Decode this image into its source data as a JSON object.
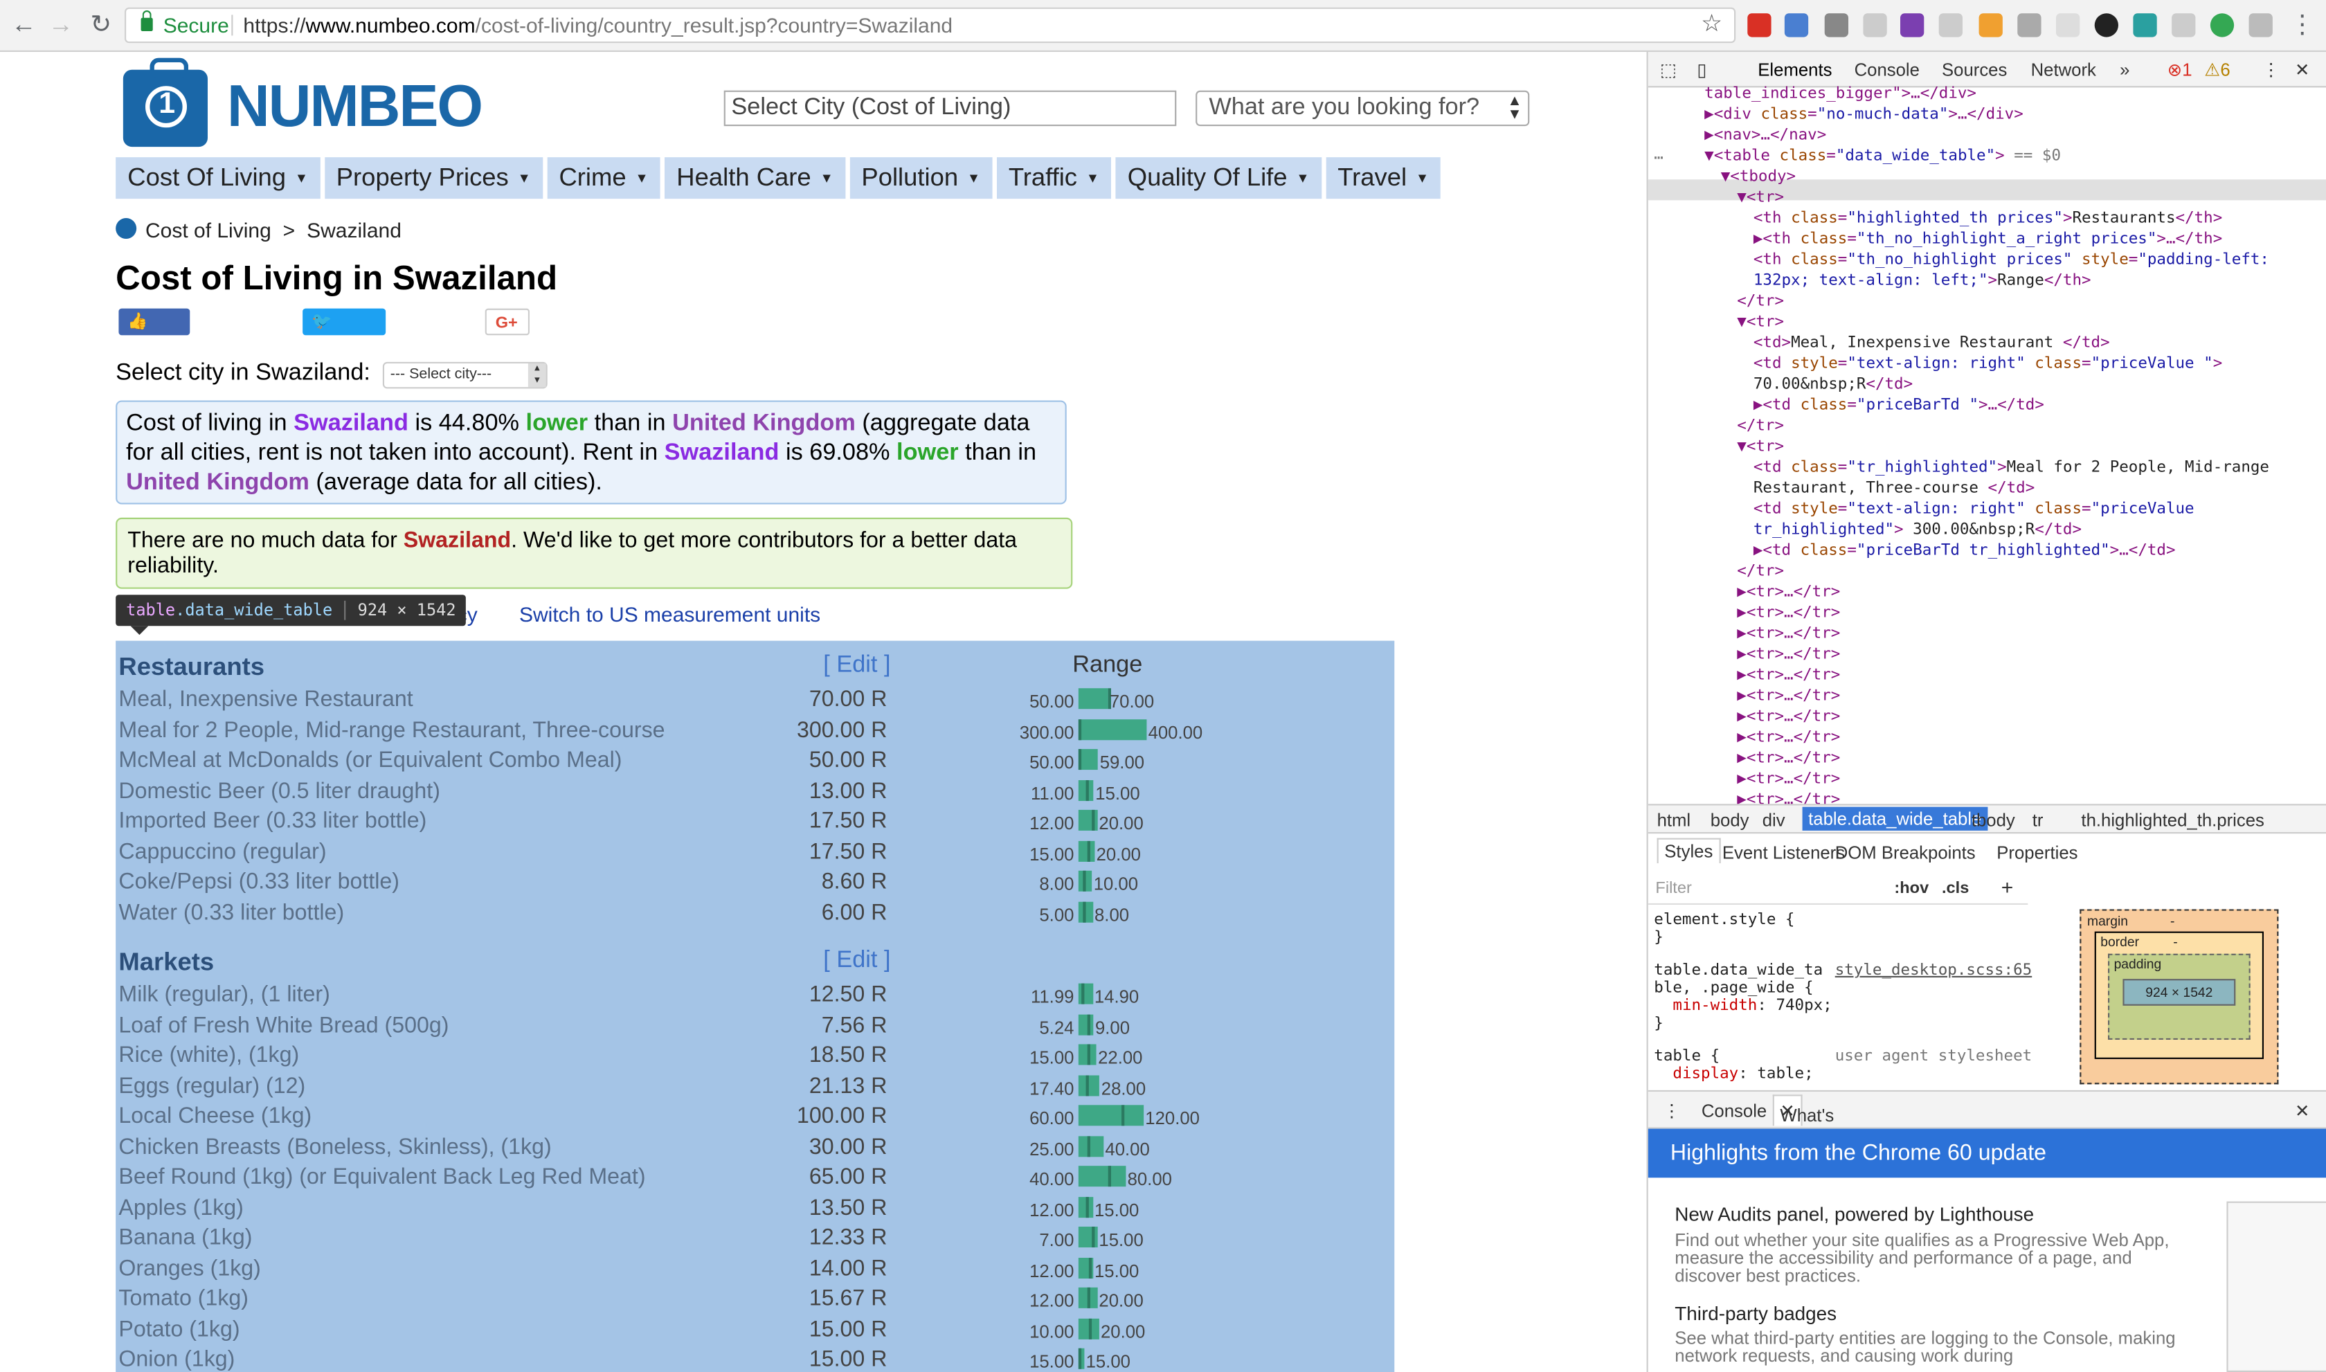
{
  "browser": {
    "secure_label": "Secure",
    "url_scheme": "https://",
    "url_host": "www.numbeo.com",
    "url_path": "/cost-of-living/country_result.jsp?country=Swaziland"
  },
  "site": {
    "logo_text": "NUMBEO",
    "city_select_placeholder": "Select City (Cost of Living)",
    "search_placeholder": "What are you looking for?",
    "menu": [
      "Cost Of Living",
      "Property Prices",
      "Crime",
      "Health Care",
      "Pollution",
      "Traffic",
      "Quality Of Life",
      "Travel"
    ],
    "breadcrumb": {
      "home": "Cost of Living",
      "sep": ">",
      "current": "Swaziland"
    },
    "title": "Cost of Living in Swaziland",
    "social": {
      "like": "Like",
      "tweet": "Tweet",
      "gplus": "G+"
    },
    "select_city_label": "Select city in Swaziland:",
    "select_city_value": "--- Select city---",
    "info": {
      "p1": "Cost of living in ",
      "country": "Swaziland",
      "p2": " is 44.80% ",
      "lower": "lower",
      "p3": " than in ",
      "uk": "United Kingdom",
      "p4": " (aggregate data for all cities, rent is not taken into account). Rent in ",
      "p5": " is 69.08% ",
      "p6": " than in ",
      "p7": " (average data for all cities)."
    },
    "warning": {
      "p1": "There are no much data for ",
      "country": "Swaziland",
      "p2": ". We'd like to get more contributors for a better data reliability."
    },
    "links": {
      "currency": "rrency",
      "units": "Switch to US measurement units"
    },
    "tooltip": {
      "tag": "table",
      "cls": ".data_wide_table",
      "dims": "924 × 1542"
    },
    "table": {
      "edit_label": "[ Edit ]",
      "range_header": "Range",
      "sections": [
        {
          "name": "Restaurants",
          "rows": [
            {
              "name": "Meal, Inexpensive Restaurant",
              "price": "70.00 R",
              "low": "50.00",
              "high": "70.00",
              "lo_n": 50,
              "hi_n": 70,
              "p_n": 70
            },
            {
              "name": "Meal for 2 People, Mid-range Restaurant, Three-course",
              "price": "300.00 R",
              "low": "300.00",
              "high": "400.00",
              "lo_n": 300,
              "hi_n": 400,
              "p_n": 300
            },
            {
              "name": "McMeal at McDonalds (or Equivalent Combo Meal)",
              "price": "50.00 R",
              "low": "50.00",
              "high": "59.00",
              "lo_n": 50,
              "hi_n": 59,
              "p_n": 50
            },
            {
              "name": "Domestic Beer (0.5 liter draught)",
              "price": "13.00 R",
              "low": "11.00",
              "high": "15.00",
              "lo_n": 11,
              "hi_n": 15,
              "p_n": 13
            },
            {
              "name": "Imported Beer (0.33 liter bottle)",
              "price": "17.50 R",
              "low": "12.00",
              "high": "20.00",
              "lo_n": 12,
              "hi_n": 20,
              "p_n": 17.5
            },
            {
              "name": "Cappuccino (regular)",
              "price": "17.50 R",
              "low": "15.00",
              "high": "20.00",
              "lo_n": 15,
              "hi_n": 20,
              "p_n": 17.5
            },
            {
              "name": "Coke/Pepsi (0.33 liter bottle)",
              "price": "8.60 R",
              "low": "8.00",
              "high": "10.00",
              "lo_n": 8,
              "hi_n": 10,
              "p_n": 8.6
            },
            {
              "name": "Water (0.33 liter bottle)",
              "price": "6.00 R",
              "low": "5.00",
              "high": "8.00",
              "lo_n": 5,
              "hi_n": 8,
              "p_n": 6
            }
          ]
        },
        {
          "name": "Markets",
          "rows": [
            {
              "name": "Milk (regular), (1 liter)",
              "price": "12.50 R",
              "low": "11.99",
              "high": "14.90",
              "lo_n": 11.99,
              "hi_n": 14.9,
              "p_n": 12.5
            },
            {
              "name": "Loaf of Fresh White Bread (500g)",
              "price": "7.56 R",
              "low": "5.24",
              "high": "9.00",
              "lo_n": 5.24,
              "hi_n": 9,
              "p_n": 7.56
            },
            {
              "name": "Rice (white), (1kg)",
              "price": "18.50 R",
              "low": "15.00",
              "high": "22.00",
              "lo_n": 15,
              "hi_n": 22,
              "p_n": 18.5
            },
            {
              "name": "Eggs (regular) (12)",
              "price": "21.13 R",
              "low": "17.40",
              "high": "28.00",
              "lo_n": 17.4,
              "hi_n": 28,
              "p_n": 21.13
            },
            {
              "name": "Local Cheese (1kg)",
              "price": "100.00 R",
              "low": "60.00",
              "high": "120.00",
              "lo_n": 60,
              "hi_n": 120,
              "p_n": 100
            },
            {
              "name": "Chicken Breasts (Boneless, Skinless), (1kg)",
              "price": "30.00 R",
              "low": "25.00",
              "high": "40.00",
              "lo_n": 25,
              "hi_n": 40,
              "p_n": 30
            },
            {
              "name": "Beef Round (1kg) (or Equivalent Back Leg Red Meat)",
              "price": "65.00 R",
              "low": "40.00",
              "high": "80.00",
              "lo_n": 40,
              "hi_n": 80,
              "p_n": 65
            },
            {
              "name": "Apples (1kg)",
              "price": "13.50 R",
              "low": "12.00",
              "high": "15.00",
              "lo_n": 12,
              "hi_n": 15,
              "p_n": 13.5
            },
            {
              "name": "Banana (1kg)",
              "price": "12.33 R",
              "low": "7.00",
              "high": "15.00",
              "lo_n": 7,
              "hi_n": 15,
              "p_n": 12.33
            },
            {
              "name": "Oranges (1kg)",
              "price": "14.00 R",
              "low": "12.00",
              "high": "15.00",
              "lo_n": 12,
              "hi_n": 15,
              "p_n": 14
            },
            {
              "name": "Tomato (1kg)",
              "price": "15.67 R",
              "low": "12.00",
              "high": "20.00",
              "lo_n": 12,
              "hi_n": 20,
              "p_n": 15.67
            },
            {
              "name": "Potato (1kg)",
              "price": "15.00 R",
              "low": "10.00",
              "high": "20.00",
              "lo_n": 10,
              "hi_n": 20,
              "p_n": 15
            },
            {
              "name": "Onion (1kg)",
              "price": "15.00 R",
              "low": "15.00",
              "high": "15.00",
              "lo_n": 15,
              "hi_n": 15,
              "p_n": 15
            }
          ]
        }
      ]
    }
  },
  "devtools": {
    "tabs": [
      "Elements",
      "Console",
      "Sources",
      "Network",
      "»"
    ],
    "errors": "1",
    "warnings": "6",
    "dom_lines": [
      {
        "indent": 0,
        "html": "<span class='t'>table_indices_bigger\"&gt;…&lt;/div&gt;</span>"
      },
      {
        "indent": 0,
        "html": "▶<span class='t'>&lt;div </span><span class='a'>class</span>=<span class='v'>\"no-much-data\"</span><span class='t'>&gt;…&lt;/div&gt;</span>"
      },
      {
        "indent": 0,
        "html": "▶<span class='t'>&lt;nav&gt;…&lt;/nav&gt;</span>"
      },
      {
        "indent": 0,
        "html": "▼<span class='t'>&lt;table </span><span class='a'>class</span>=<span class='v'>\"data_wide_table\"</span><span class='t'>&gt;</span> <span class='g'>== $0</span>"
      },
      {
        "indent": 1,
        "html": "▼<span class='t'>&lt;tbody&gt;</span>"
      },
      {
        "indent": 2,
        "html": "▼<span class='t'>&lt;tr&gt;</span>"
      },
      {
        "indent": 3,
        "html": "<span class='t'>&lt;th </span><span class='a'>class</span>=<span class='v'>\"highlighted_th prices\"</span><span class='t'>&gt;</span><span class='x'>Restaurants</span><span class='t'>&lt;/th&gt;</span>"
      },
      {
        "indent": 3,
        "html": "▶<span class='t'>&lt;th </span><span class='a'>class</span>=<span class='v'>\"th_no_highlight_a_right prices\"</span><span class='t'>&gt;…&lt;/th&gt;</span>"
      },
      {
        "indent": 3,
        "html": "<span class='t'>&lt;th </span><span class='a'>class</span>=<span class='v'>\"th_no_highlight prices\"</span> <span class='a'>style</span>=<span class='v'>\"padding-left:</span>"
      },
      {
        "indent": 3,
        "html": "<span class='v'>132px; text-align: left;\"</span><span class='t'>&gt;</span><span class='x'>Range</span><span class='t'>&lt;/th&gt;</span>"
      },
      {
        "indent": 2,
        "html": "<span class='t'>&lt;/tr&gt;</span>"
      },
      {
        "indent": 2,
        "html": "▼<span class='t'>&lt;tr&gt;</span>"
      },
      {
        "indent": 3,
        "html": "<span class='t'>&lt;td&gt;</span><span class='x'>Meal, Inexpensive Restaurant </span><span class='t'>&lt;/td&gt;</span>"
      },
      {
        "indent": 3,
        "html": "<span class='t'>&lt;td </span><span class='a'>style</span>=<span class='v'>\"text-align: right\"</span> <span class='a'>class</span>=<span class='v'>\"priceValue \"</span><span class='t'>&gt;</span>"
      },
      {
        "indent": 3,
        "html": "<span class='x'>70.00&amp;nbsp;R</span><span class='t'>&lt;/td&gt;</span>"
      },
      {
        "indent": 3,
        "html": "▶<span class='t'>&lt;td </span><span class='a'>class</span>=<span class='v'>\"priceBarTd \"</span><span class='t'>&gt;…&lt;/td&gt;</span>"
      },
      {
        "indent": 2,
        "html": "<span class='t'>&lt;/tr&gt;</span>"
      },
      {
        "indent": 2,
        "html": "▼<span class='t'>&lt;tr&gt;</span>"
      },
      {
        "indent": 3,
        "html": "<span class='t'>&lt;td </span><span class='a'>class</span>=<span class='v'>\"tr_highlighted\"</span><span class='t'>&gt;</span><span class='x'>Meal for 2 People, Mid-range</span>"
      },
      {
        "indent": 3,
        "html": "<span class='x'>Restaurant, Three-course </span><span class='t'>&lt;/td&gt;</span>"
      },
      {
        "indent": 3,
        "html": "<span class='t'>&lt;td </span><span class='a'>style</span>=<span class='v'>\"text-align: right\"</span> <span class='a'>class</span>=<span class='v'>\"priceValue</span>"
      },
      {
        "indent": 3,
        "html": "<span class='v'>tr_highlighted\"</span><span class='t'>&gt;</span><span class='x'> 300.00&amp;nbsp;R</span><span class='t'>&lt;/td&gt;</span>"
      },
      {
        "indent": 3,
        "html": "▶<span class='t'>&lt;td </span><span class='a'>class</span>=<span class='v'>\"priceBarTd tr_highlighted\"</span><span class='t'>&gt;…&lt;/td&gt;</span>"
      },
      {
        "indent": 2,
        "html": "<span class='t'>&lt;/tr&gt;</span>"
      },
      {
        "indent": 2,
        "html": "▶<span class='t'>&lt;tr&gt;…&lt;/tr&gt;</span>"
      },
      {
        "indent": 2,
        "html": "▶<span class='t'>&lt;tr&gt;…&lt;/tr&gt;</span>"
      },
      {
        "indent": 2,
        "html": "▶<span class='t'>&lt;tr&gt;…&lt;/tr&gt;</span>"
      },
      {
        "indent": 2,
        "html": "▶<span class='t'>&lt;tr&gt;…&lt;/tr&gt;</span>"
      },
      {
        "indent": 2,
        "html": "▶<span class='t'>&lt;tr&gt;…&lt;/tr&gt;</span>"
      },
      {
        "indent": 2,
        "html": "▶<span class='t'>&lt;tr&gt;…&lt;/tr&gt;</span>"
      },
      {
        "indent": 2,
        "html": "▶<span class='t'>&lt;tr&gt;…&lt;/tr&gt;</span>"
      },
      {
        "indent": 2,
        "html": "▶<span class='t'>&lt;tr&gt;…&lt;/tr&gt;</span>"
      },
      {
        "indent": 2,
        "html": "▶<span class='t'>&lt;tr&gt;…&lt;/tr&gt;</span>"
      },
      {
        "indent": 2,
        "html": "▶<span class='t'>&lt;tr&gt;…&lt;/tr&gt;</span>"
      },
      {
        "indent": 2,
        "html": "▶<span class='t'>&lt;tr&gt;…&lt;/tr&gt;</span>"
      },
      {
        "indent": 2,
        "html": "▶<span class='t'>&lt;tr&gt;…&lt;/tr&gt;</span>"
      }
    ],
    "breadcrumbs": [
      "html",
      "body",
      "div",
      "table.data_wide_table",
      "tbody",
      "tr",
      "th.highlighted_th.prices"
    ],
    "style_tabs": [
      "Styles",
      "Event Listeners",
      "DOM Breakpoints",
      "Properties"
    ],
    "filter_placeholder": "Filter",
    "filter_hov": ":hov",
    "filter_cls": ".cls",
    "css_rules": {
      "element_style": "element.style {",
      "close": "}",
      "sel1": "table.data_wide_ta",
      "sel1b": "ble, .page_wide {",
      "src1": "style_desktop.scss:65",
      "prop1": "min-width",
      "val1": ": 740px;",
      "sel2": "table {",
      "src2": "user agent stylesheet",
      "prop2": "display",
      "val2": ": table;"
    },
    "boxmodel": {
      "margin": "margin",
      "border": "border",
      "padding": "padding",
      "content": "924 × 1542",
      "dash": "-"
    },
    "drawer_tabs": [
      "Console",
      "What's New"
    ],
    "banner": "Highlights from the Chrome 60 update",
    "news": [
      {
        "title": "New Audits panel, powered by Lighthouse",
        "body": "Find out whether your site qualifies as a Progressive Web App, measure the accessibility and performance of a page, and discover best practices."
      },
      {
        "title": "Third-party badges",
        "body": "See what third-party entities are logging to the Console, making network requests, and causing work during"
      }
    ]
  },
  "colors": {
    "accent": "#1a67a8",
    "bar": "#3ea886",
    "table_bg": "#a4c4e6",
    "devtools_blue": "#2c72d8"
  }
}
